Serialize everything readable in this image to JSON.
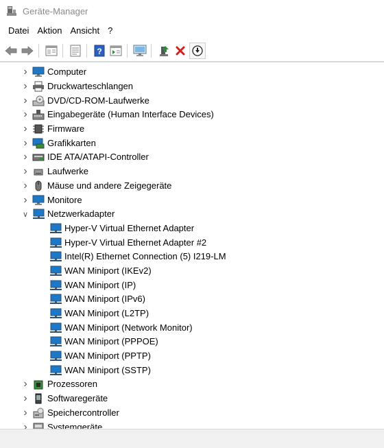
{
  "window": {
    "title": "Geräte-Manager",
    "icon": "device-manager-icon"
  },
  "menu": [
    {
      "label": "Datei"
    },
    {
      "label": "Aktion"
    },
    {
      "label": "Ansicht"
    },
    {
      "label": "?"
    }
  ],
  "toolbar": {
    "buttons": [
      {
        "icon": "back-arrow-icon"
      },
      {
        "icon": "forward-arrow-icon"
      },
      {
        "icon": "properties-window-icon"
      },
      {
        "icon": "document-list-icon"
      },
      {
        "icon": "help-icon"
      },
      {
        "icon": "details-pane-icon"
      },
      {
        "icon": "monitor-scan-icon"
      },
      {
        "icon": "update-driver-icon"
      },
      {
        "icon": "uninstall-x-icon"
      },
      {
        "icon": "download-circle-icon"
      }
    ]
  },
  "tree": {
    "categories": [
      {
        "label": "Computer",
        "icon": "computer-icon",
        "expanded": false
      },
      {
        "label": "Druckwarteschlangen",
        "icon": "printer-icon",
        "expanded": false
      },
      {
        "label": "DVD/CD-ROM-Laufwerke",
        "icon": "dvd-drive-icon",
        "expanded": false
      },
      {
        "label": "Eingabegeräte (Human Interface Devices)",
        "icon": "hid-icon",
        "expanded": false
      },
      {
        "label": "Firmware",
        "icon": "firmware-icon",
        "expanded": false
      },
      {
        "label": "Grafikkarten",
        "icon": "display-adapter-icon",
        "expanded": false
      },
      {
        "label": "IDE ATA/ATAPI-Controller",
        "icon": "ide-controller-icon",
        "expanded": false
      },
      {
        "label": "Laufwerke",
        "icon": "disk-drive-icon",
        "expanded": false
      },
      {
        "label": "Mäuse und andere Zeigegeräte",
        "icon": "mouse-icon",
        "expanded": false
      },
      {
        "label": "Monitore",
        "icon": "monitor-icon",
        "expanded": false
      },
      {
        "label": "Netzwerkadapter",
        "icon": "network-adapter-icon",
        "expanded": true,
        "children": [
          {
            "label": "Hyper-V Virtual Ethernet Adapter"
          },
          {
            "label": "Hyper-V Virtual Ethernet Adapter #2"
          },
          {
            "label": "Intel(R) Ethernet Connection (5) I219-LM"
          },
          {
            "label": "WAN Miniport (IKEv2)"
          },
          {
            "label": "WAN Miniport (IP)"
          },
          {
            "label": "WAN Miniport (IPv6)"
          },
          {
            "label": "WAN Miniport (L2TP)"
          },
          {
            "label": "WAN Miniport (Network Monitor)"
          },
          {
            "label": "WAN Miniport (PPPOE)"
          },
          {
            "label": "WAN Miniport (PPTP)"
          },
          {
            "label": "WAN Miniport (SSTP)"
          }
        ]
      },
      {
        "label": "Prozessoren",
        "icon": "processor-icon",
        "expanded": false
      },
      {
        "label": "Softwaregeräte",
        "icon": "software-device-icon",
        "expanded": false
      },
      {
        "label": "Speichercontroller",
        "icon": "storage-controller-icon",
        "expanded": false
      },
      {
        "label": "Systemgeräte",
        "icon": "system-device-icon",
        "expanded": false
      }
    ]
  },
  "colors": {
    "monitor_blue": "#1e78c8",
    "toolbar_help_blue": "#2b5fc0",
    "uninstall_red": "#d21f1f",
    "update_green": "#2e8b3a"
  }
}
